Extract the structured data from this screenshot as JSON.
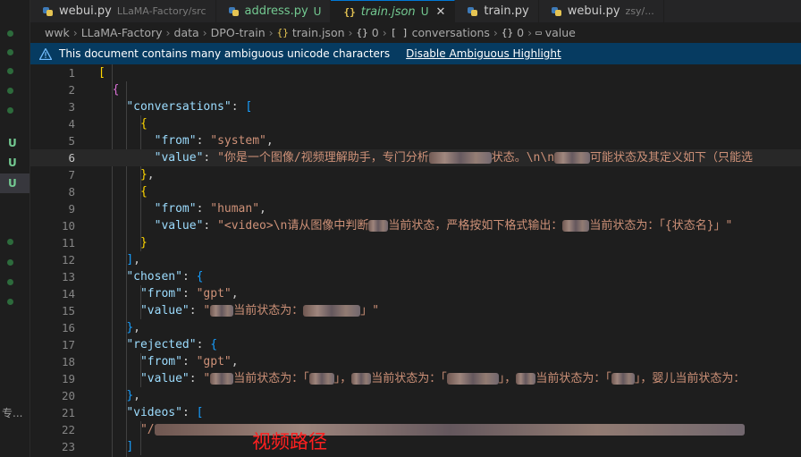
{
  "tabs": [
    {
      "name": "webui.py",
      "desc": "LLaMA-Factory/src",
      "badge": "",
      "type": "py"
    },
    {
      "name": "address.py",
      "desc": "",
      "badge": "U",
      "type": "py"
    },
    {
      "name": "train.json",
      "desc": "",
      "badge": "U",
      "type": "json",
      "active": true
    },
    {
      "name": "train.py",
      "desc": "",
      "badge": "",
      "type": "py"
    },
    {
      "name": "webui.py",
      "desc": "zsy/...",
      "badge": "",
      "type": "py"
    }
  ],
  "breadcrumb": {
    "items": [
      "wwk",
      "LLaMA-Factory",
      "data",
      "DPO-train"
    ],
    "file": "train.json",
    "obj0": "0",
    "arr": "conversations",
    "obj1": "0",
    "prop": "value"
  },
  "banner": {
    "message": "This document contains many ambiguous unicode characters",
    "action": "Disable Ambiguous Highlight"
  },
  "editor": {
    "line_numbers": [
      "1",
      "2",
      "3",
      "4",
      "5",
      "6",
      "7",
      "8",
      "9",
      "10",
      "11",
      "12",
      "13",
      "14",
      "15",
      "16",
      "17",
      "18",
      "19",
      "20",
      "21",
      "22",
      "23"
    ],
    "current_line": "6",
    "lines": {
      "l3_key": "\"conversations\"",
      "l5_key": "\"from\"",
      "l5_val": "\"system\"",
      "l6_key": "\"value\"",
      "l6_val_a": "\"你是一个图像/视频理解助手，专门分析",
      "l6_val_b": "状态。\\n\\n",
      "l6_val_c": "可能状态及其定义如下（只能选",
      "l9_key": "\"from\"",
      "l9_val": "\"human\"",
      "l10_key": "\"value\"",
      "l10_val_a": "\"<video>\\n请从图像中判断",
      "l10_val_b": "当前状态，严格按如下格式输出：",
      "l10_val_c": "当前状态为：「{状态名}」\"",
      "l13_key": "\"chosen\"",
      "l14_key": "\"from\"",
      "l14_val": "\"gpt\"",
      "l15_key": "\"value\"",
      "l15_val_a": "\"",
      "l15_val_b": "当前状态为：",
      "l15_val_c": "」\"",
      "l17_key": "\"rejected\"",
      "l18_key": "\"from\"",
      "l18_val": "\"gpt\"",
      "l19_key": "\"value\"",
      "l19_val_a": "\"",
      "l19_val_b": "当前状态为：「",
      "l19_val_c": "」，",
      "l19_val_d": "当前状态为：「",
      "l19_val_e": "」，",
      "l19_val_f": "当前状态为：「",
      "l19_val_g": "」，婴儿当前状态为：",
      "l21_key": "\"videos\"",
      "l22_val_a": "\"/"
    }
  },
  "annotation": "视频路径",
  "gutter": {
    "u_badge": "U",
    "chinese": "专..."
  }
}
